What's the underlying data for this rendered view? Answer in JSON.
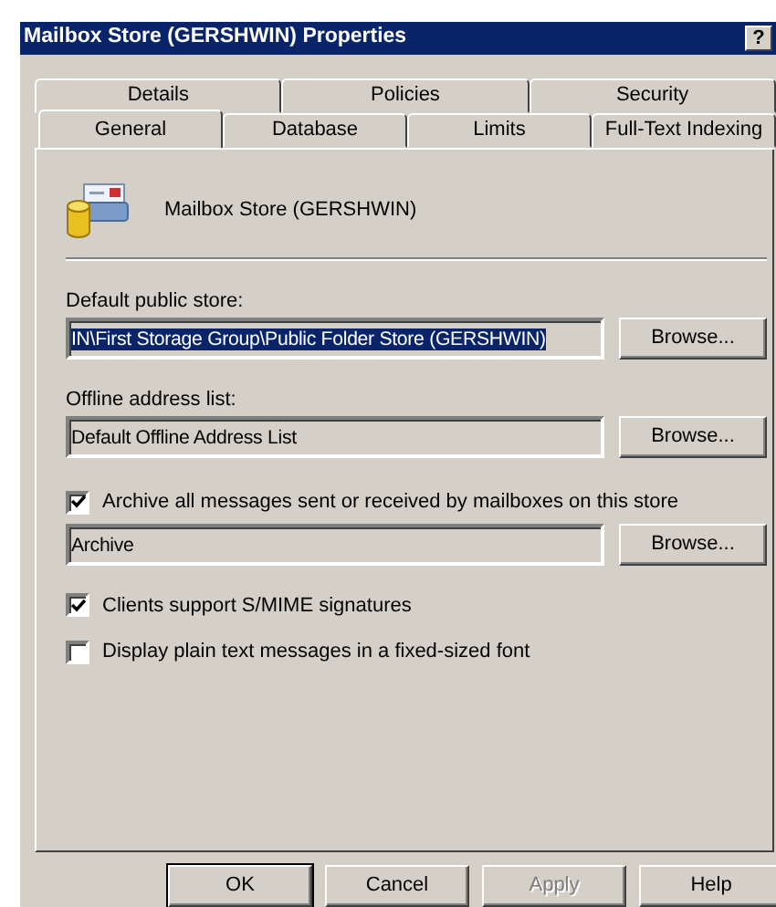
{
  "window": {
    "title": "Mailbox Store (GERSHWIN) Properties",
    "help_button": "?"
  },
  "tab_rows": [
    [
      {
        "label": "Details",
        "selected": false
      },
      {
        "label": "Policies",
        "selected": false
      },
      {
        "label": "Security",
        "selected": false
      }
    ],
    [
      {
        "label": "General",
        "selected": true
      },
      {
        "label": "Database",
        "selected": false
      },
      {
        "label": "Limits",
        "selected": false
      },
      {
        "label": "Full-Text Indexing",
        "selected": false
      }
    ]
  ],
  "header": {
    "name": "Mailbox Store (GERSHWIN)"
  },
  "items": [
    {
      "kind": "field",
      "label": "Default public store:",
      "value": "IN\\First Storage Group\\Public Folder Store (GERSHWIN)",
      "value_selected": true,
      "button": "Browse..."
    },
    {
      "kind": "field",
      "label": "Offline address list:",
      "value": "Default Offline Address List",
      "value_selected": false,
      "button": "Browse..."
    },
    {
      "kind": "checkbox_field",
      "label": "Archive all messages sent or received by mailboxes on this store",
      "checked": true,
      "value": "Archive",
      "button": "Browse..."
    },
    {
      "kind": "checkbox",
      "label": "Clients support S/MIME signatures",
      "checked": true
    },
    {
      "kind": "checkbox",
      "label": "Display plain text messages in a fixed-sized font",
      "checked": false
    }
  ],
  "buttons": [
    {
      "label": "OK",
      "default": true,
      "disabled": false
    },
    {
      "label": "Cancel",
      "default": false,
      "disabled": false
    },
    {
      "label": "Apply",
      "default": false,
      "disabled": true
    },
    {
      "label": "Help",
      "default": false,
      "disabled": false
    }
  ]
}
